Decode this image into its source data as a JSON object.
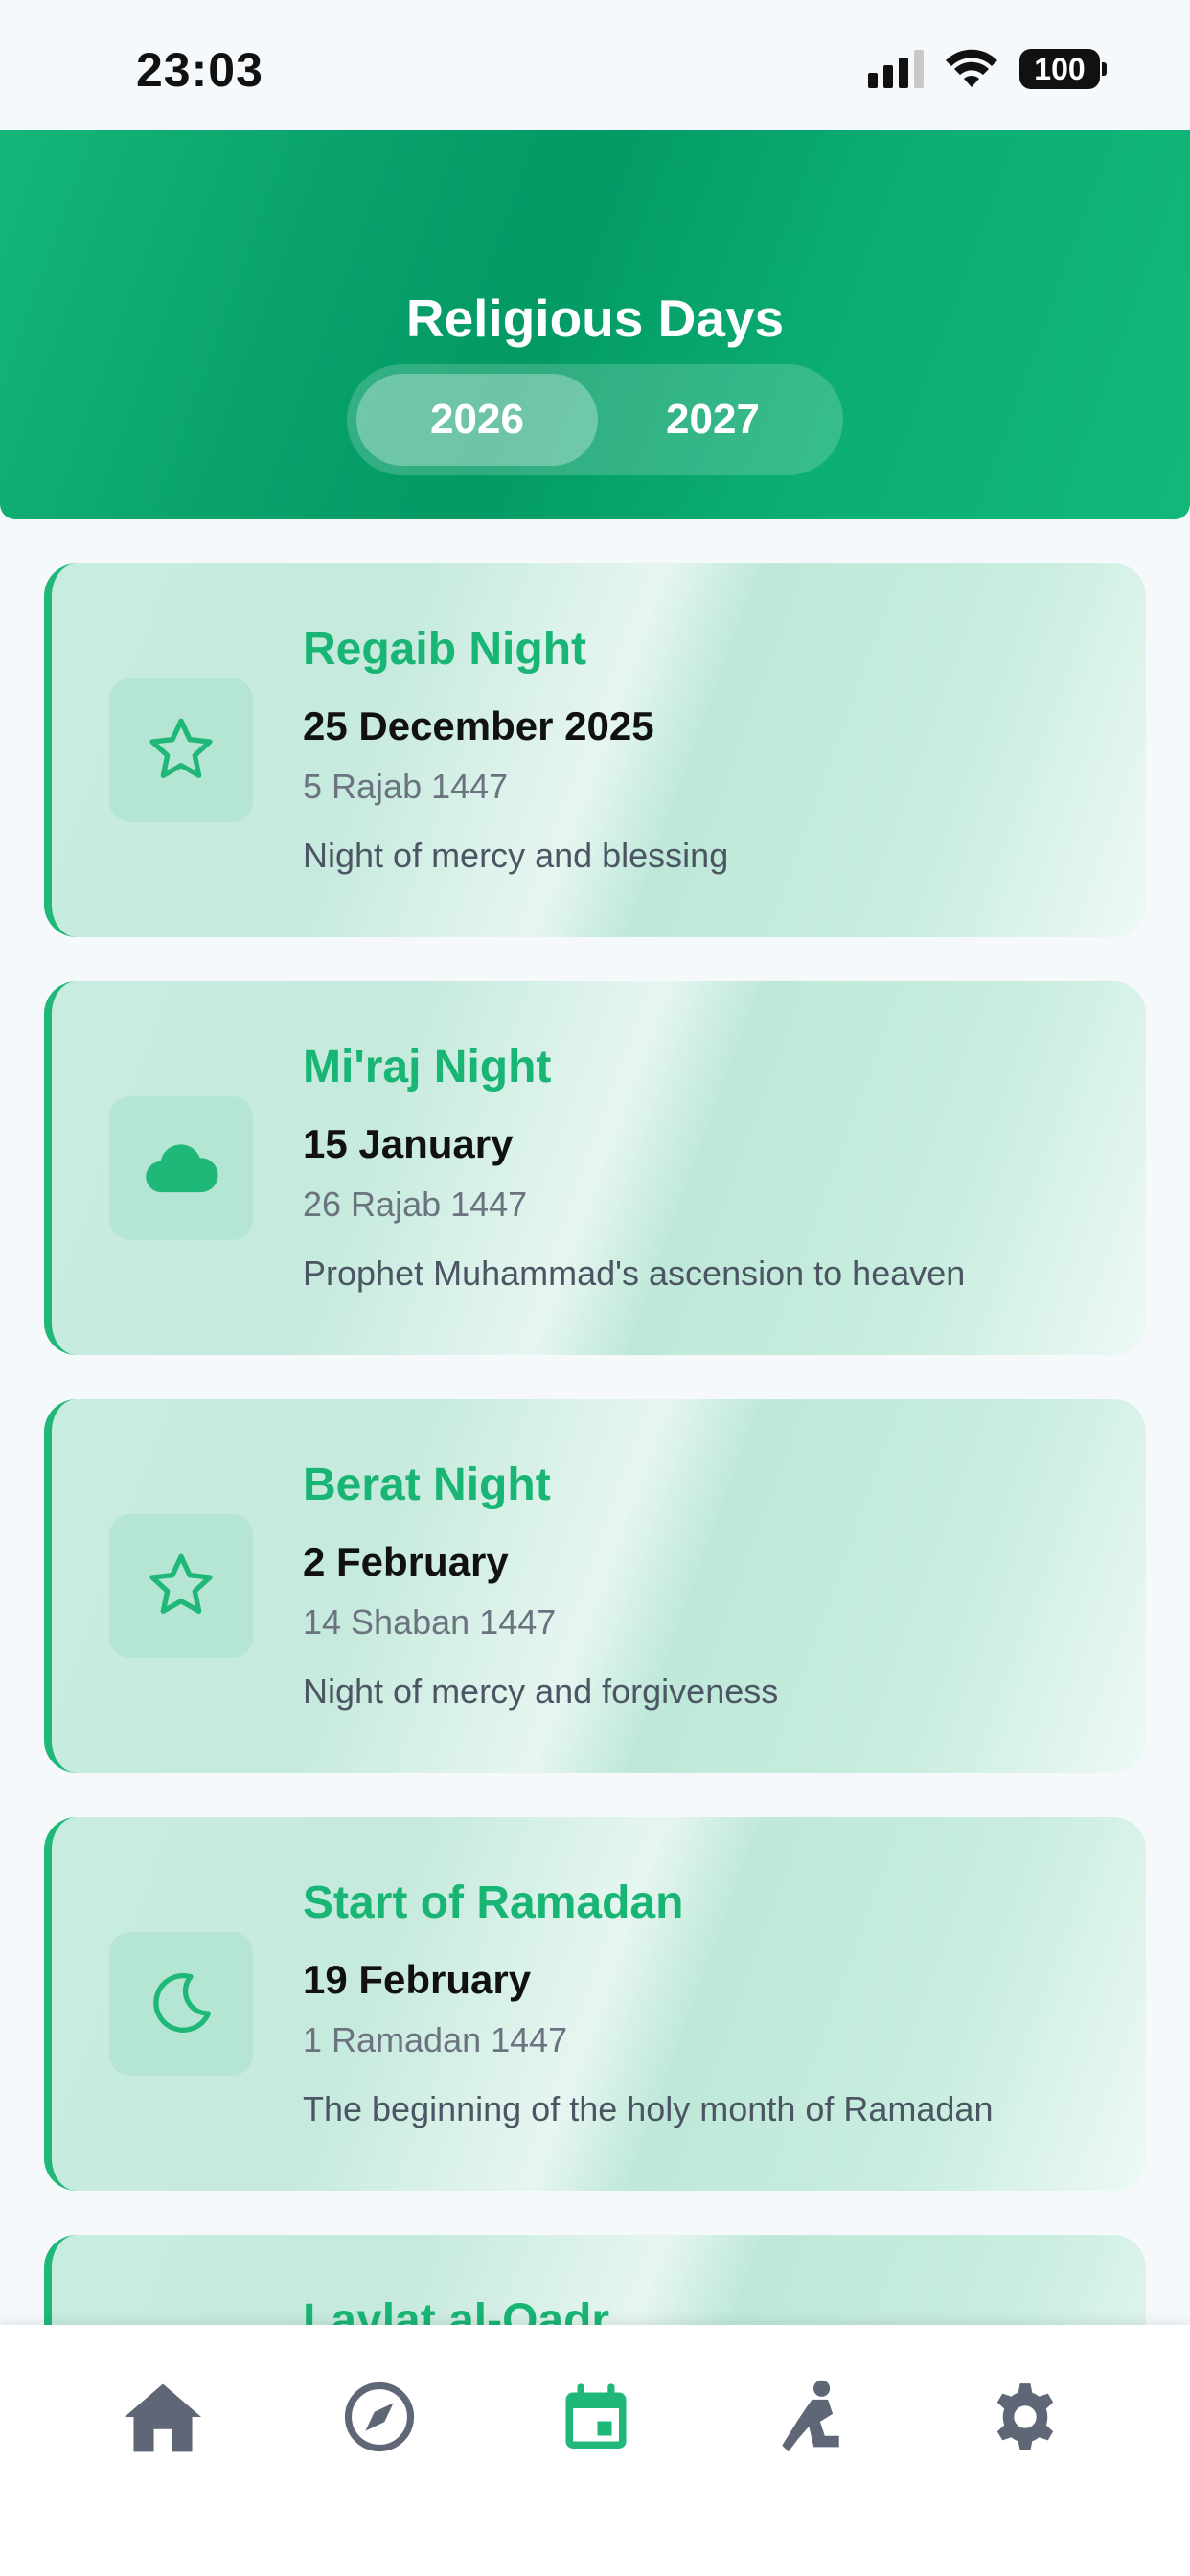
{
  "status_bar": {
    "time": "23:03",
    "battery": "100"
  },
  "header": {
    "title": "Religious Days",
    "years": [
      {
        "label": "2026",
        "active": true
      },
      {
        "label": "2027",
        "active": false
      }
    ]
  },
  "events": [
    {
      "title": "Regaib Night",
      "date": "25 December 2025",
      "hijri": "5 Rajab 1447",
      "description": "Night of mercy and blessing",
      "icon": "star-icon"
    },
    {
      "title": "Mi'raj Night",
      "date": "15 January",
      "hijri": "26 Rajab 1447",
      "description": "Prophet Muhammad's ascension to heaven",
      "icon": "cloud-icon"
    },
    {
      "title": "Berat Night",
      "date": "2 February",
      "hijri": "14 Shaban 1447",
      "description": "Night of mercy and forgiveness",
      "icon": "star-icon"
    },
    {
      "title": "Start of Ramadan",
      "date": "19 February",
      "hijri": "1 Ramadan 1447",
      "description": "The beginning of the holy month of Ramadan",
      "icon": "moon-icon"
    },
    {
      "title": "Laylat al-Qadr",
      "date": "",
      "hijri": "",
      "description": "",
      "icon": ""
    }
  ],
  "bottom_nav": [
    {
      "name": "home",
      "icon": "home-icon",
      "active": false
    },
    {
      "name": "qibla",
      "icon": "compass-icon",
      "active": false
    },
    {
      "name": "calendar",
      "icon": "calendar-icon",
      "active": true
    },
    {
      "name": "prayer",
      "icon": "prayer-icon",
      "active": false
    },
    {
      "name": "settings",
      "icon": "gear-icon",
      "active": false
    }
  ],
  "colors": {
    "accent": "#1fb878",
    "header_green": "#0aa36c",
    "nav_inactive": "#5f6675"
  }
}
